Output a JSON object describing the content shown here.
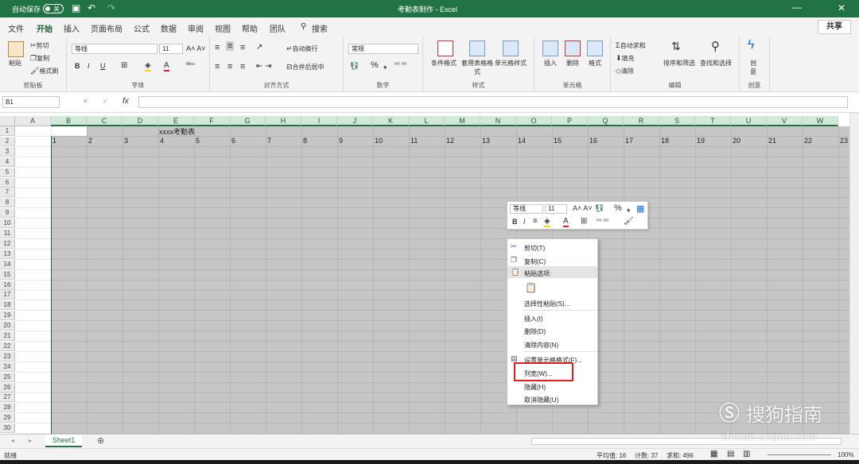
{
  "title_bar": {
    "autosave_label": "自动保存",
    "autosave_state": "关",
    "doc_title": "考勤表制作 - Excel"
  },
  "tabs": [
    "文件",
    "开始",
    "插入",
    "页面布局",
    "公式",
    "数据",
    "审阅",
    "视图",
    "帮助",
    "团队",
    "搜索"
  ],
  "share_label": "共享",
  "ribbon": {
    "clipboard": {
      "paste": "粘贴",
      "cut": "剪切",
      "copy": "复制",
      "format_painter": "格式刷",
      "group": "剪贴板"
    },
    "font": {
      "name": "等线",
      "size": "11",
      "group": "字体",
      "bold": "B",
      "italic": "I",
      "underline": "U"
    },
    "alignment": {
      "wrap": "自动换行",
      "merge": "合并后居中",
      "group": "对齐方式"
    },
    "number": {
      "format": "常规",
      "group": "数字",
      "percent": "%"
    },
    "styles": {
      "cond": "条件格式",
      "table": "套用表格格式",
      "cell": "单元格样式",
      "group": "样式"
    },
    "cells": {
      "insert": "插入",
      "delete": "删除",
      "format": "格式",
      "group": "单元格"
    },
    "editing": {
      "autosum": "自动求和",
      "fill": "填充",
      "clear": "清除",
      "sort": "排序和筛选",
      "find": "查找和选择",
      "group": "编辑"
    },
    "create": {
      "btn": "创意",
      "group": "创意"
    }
  },
  "formula_bar": {
    "name_box": "B1",
    "fx": "fx",
    "cancel": "✕",
    "enter": "✓"
  },
  "columns": [
    "A",
    "B",
    "C",
    "D",
    "E",
    "F",
    "G",
    "H",
    "I",
    "J",
    "K",
    "L",
    "M",
    "N",
    "O",
    "P",
    "Q",
    "R",
    "S",
    "T",
    "U",
    "V",
    "W"
  ],
  "rows": [
    "1",
    "2",
    "3",
    "4",
    "5",
    "6",
    "7",
    "8",
    "9",
    "10",
    "11",
    "12",
    "13",
    "14",
    "15",
    "16",
    "17",
    "18",
    "19",
    "20",
    "21",
    "22",
    "23",
    "24",
    "25",
    "26",
    "27",
    "28",
    "29",
    "30"
  ],
  "cells": {
    "title": "xxxx考勤表",
    "days": [
      "1",
      "2",
      "3",
      "4",
      "5",
      "6",
      "7",
      "8",
      "9",
      "10",
      "11",
      "12",
      "13",
      "14",
      "15",
      "16",
      "17",
      "18",
      "19",
      "20",
      "21",
      "22",
      "23"
    ]
  },
  "mini_toolbar": {
    "font": "等线",
    "size": "11",
    "bold": "B",
    "italic": "I",
    "percent": "%"
  },
  "context_menu": [
    {
      "label": "剪切(T)",
      "icon": "scissors-icon"
    },
    {
      "label": "复制(C)",
      "icon": "copy-icon"
    },
    {
      "label": "粘贴选项:",
      "icon": "paste-icon"
    },
    {
      "label": "",
      "icon": "paste-a-icon"
    },
    {
      "label": "选择性粘贴(S)...",
      "icon": ""
    },
    {
      "label": "插入(I)",
      "icon": ""
    },
    {
      "label": "删除(D)",
      "icon": ""
    },
    {
      "label": "清除内容(N)",
      "icon": ""
    },
    {
      "label": "设置单元格格式(F)...",
      "icon": "format-cells-icon"
    },
    {
      "label": "列宽(W)...",
      "icon": ""
    },
    {
      "label": "隐藏(H)",
      "icon": ""
    },
    {
      "label": "取消隐藏(U)",
      "icon": ""
    }
  ],
  "sheet_tab": "Sheet1",
  "status": {
    "ready": "就绪",
    "average": "平均值: 16",
    "count": "计数: 37",
    "sum": "求和: 496",
    "zoom": "100%"
  },
  "watermark": {
    "text": "搜狗指南",
    "url": "zhinan.sogou.com"
  },
  "colors": {
    "accent": "#217346",
    "selection": "#c6c6c6",
    "red_box": "#e02020"
  }
}
